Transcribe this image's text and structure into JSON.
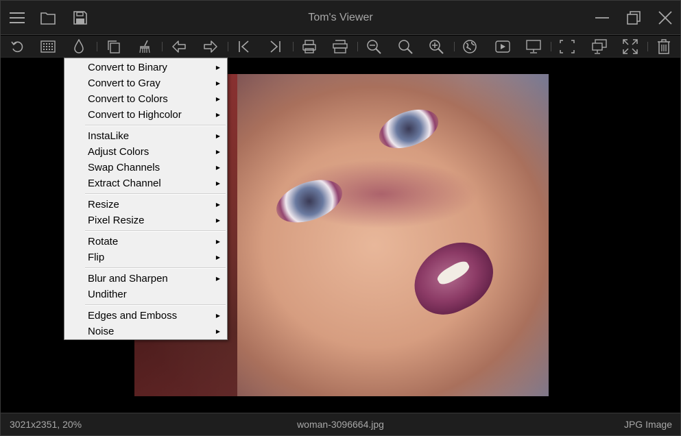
{
  "window": {
    "title": "Tom's Viewer"
  },
  "titlebar": {
    "left_icons": [
      "menu-icon",
      "folder-open-icon",
      "save-icon"
    ],
    "right_icons": [
      "minimize-icon",
      "restore-icon",
      "close-icon"
    ]
  },
  "toolbar": {
    "tools": [
      "undo-icon",
      "grid-icon",
      "color-drop-icon",
      "copy-icon",
      "clean-brush-icon",
      "arrow-left-icon",
      "arrow-right-icon",
      "skip-first-icon",
      "skip-last-icon",
      "print-icon",
      "scanner-icon",
      "zoom-out-icon",
      "zoom-fit-icon",
      "zoom-in-icon",
      "globe-icon",
      "slideshow-icon",
      "monitor-icon",
      "select-area-icon",
      "screen-copy-icon",
      "fullscreen-icon",
      "trash-icon"
    ]
  },
  "context_menu": {
    "groups": [
      [
        {
          "label": "Convert to Binary",
          "submenu": true
        },
        {
          "label": "Convert to Gray",
          "submenu": true
        },
        {
          "label": "Convert to Colors",
          "submenu": true
        },
        {
          "label": "Convert to Highcolor",
          "submenu": true
        }
      ],
      [
        {
          "label": "InstaLike",
          "submenu": true
        },
        {
          "label": "Adjust Colors",
          "submenu": true
        },
        {
          "label": "Swap Channels",
          "submenu": true
        },
        {
          "label": "Extract Channel",
          "submenu": true
        }
      ],
      [
        {
          "label": "Resize",
          "submenu": true
        },
        {
          "label": "Pixel Resize",
          "submenu": true
        }
      ],
      [
        {
          "label": "Rotate",
          "submenu": true
        },
        {
          "label": "Flip",
          "submenu": true
        }
      ],
      [
        {
          "label": "Blur and Sharpen",
          "submenu": true
        },
        {
          "label": "Undither",
          "submenu": false
        }
      ],
      [
        {
          "label": "Edges and Emboss",
          "submenu": true
        },
        {
          "label": "Noise",
          "submenu": true
        }
      ]
    ]
  },
  "status": {
    "dimensions_zoom": "3021x2351, 20%",
    "filename": "woman-3096664.jpg",
    "file_type": "JPG Image"
  },
  "colors": {
    "chrome_bg": "#1e1e1e",
    "icon_color": "#a8a8a8",
    "menu_bg": "#f0f0f0"
  }
}
